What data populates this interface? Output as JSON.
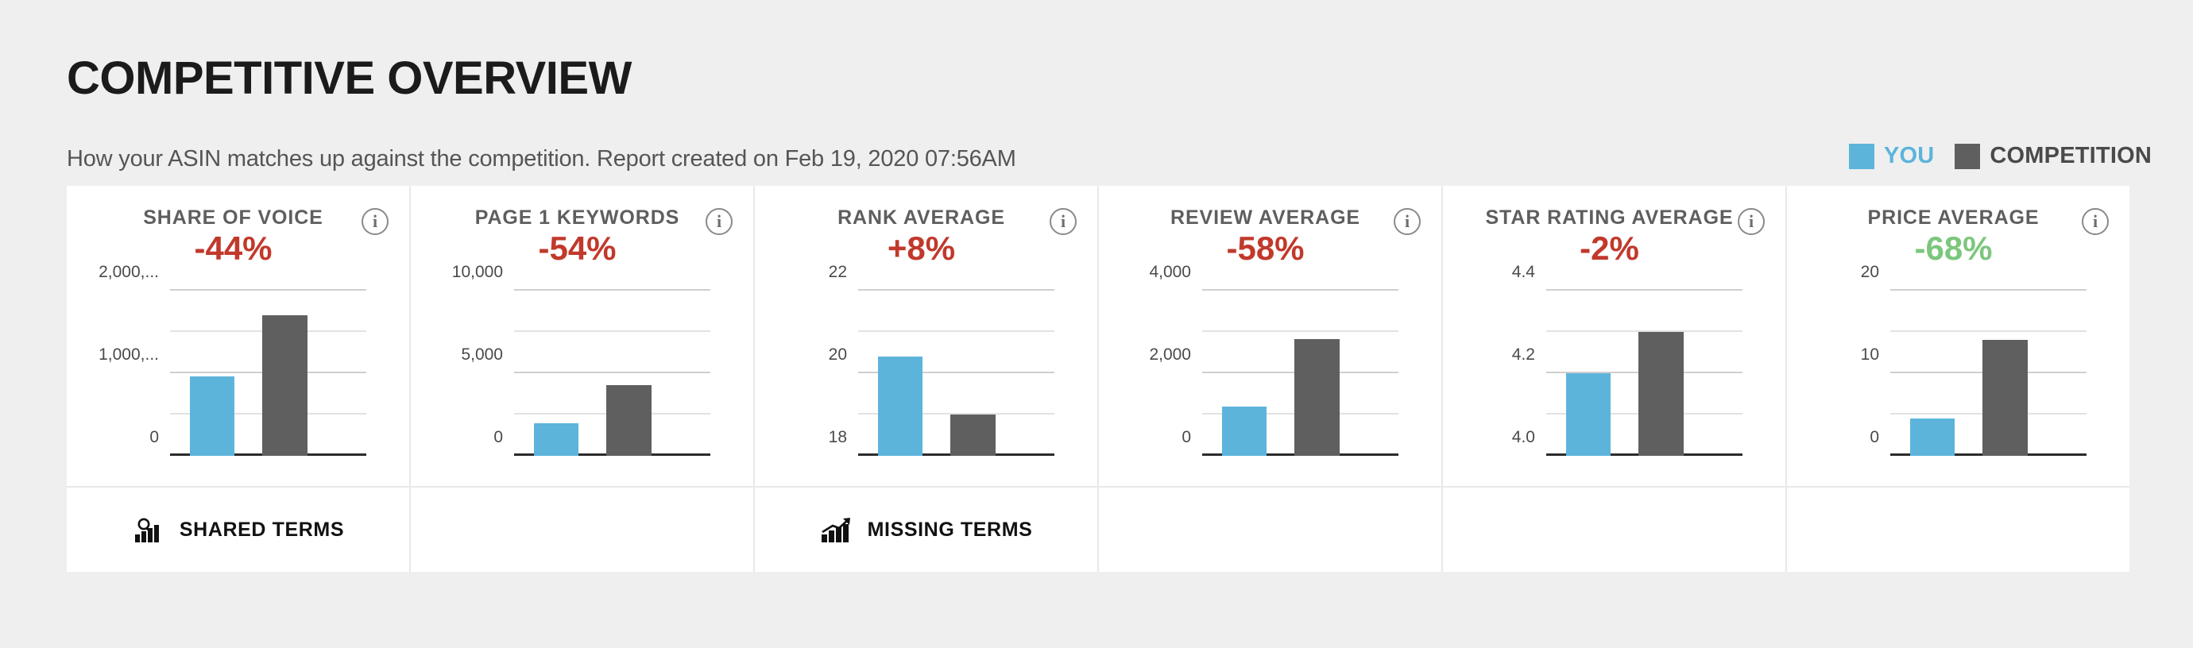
{
  "header": {
    "title": "COMPETITIVE OVERVIEW",
    "subtitle": "How your ASIN matches up against the competition. Report created on Feb 19, 2020 07:56AM"
  },
  "legend": {
    "you_label": "YOU",
    "you_color": "#5CB4DB",
    "competition_label": "COMPETITION",
    "competition_color": "#605F5F"
  },
  "colors": {
    "negative": "#C1392B",
    "positive": "#7DC67D",
    "page_background": "#EFEFEF",
    "card_background": "#FFFFFF",
    "divider": "#E8E8E8"
  },
  "info_icon_glyph": "i",
  "cards": [
    {
      "title": "SHARE OF VOICE",
      "delta": "-44%",
      "delta_sign": "negative",
      "info_icon": "info-icon",
      "footer": {
        "label": "SHARED TERMS",
        "icon": "shared-terms-icon"
      },
      "chart_data": {
        "type": "bar",
        "title": "SHARE OF VOICE",
        "categories": [
          "YOU",
          "COMPETITION"
        ],
        "values": [
          960000,
          1700000
        ],
        "series": [
          {
            "name": "YOU",
            "values": [
              960000
            ]
          },
          {
            "name": "COMPETITION",
            "values": [
              1700000
            ]
          }
        ],
        "ylim": [
          0,
          2000000
        ],
        "yticks": [
          0,
          1000000,
          2000000
        ],
        "ytick_labels": [
          "0",
          "1,000,...",
          "2,000,..."
        ],
        "minor_gridlines": [
          500000,
          1500000
        ],
        "xlabel": "",
        "ylabel": "",
        "grid": true,
        "legend": "top-right"
      }
    },
    {
      "title": "PAGE 1 KEYWORDS",
      "delta": "-54%",
      "delta_sign": "negative",
      "info_icon": "info-icon",
      "footer": null,
      "chart_data": {
        "type": "bar",
        "title": "PAGE 1 KEYWORDS",
        "categories": [
          "YOU",
          "COMPETITION"
        ],
        "values": [
          1950,
          4300
        ],
        "series": [
          {
            "name": "YOU",
            "values": [
              1950
            ]
          },
          {
            "name": "COMPETITION",
            "values": [
              4300
            ]
          }
        ],
        "ylim": [
          0,
          10000
        ],
        "yticks": [
          0,
          5000,
          10000
        ],
        "ytick_labels": [
          "0",
          "5,000",
          "10,000"
        ],
        "minor_gridlines": [
          2500,
          7500
        ],
        "xlabel": "",
        "ylabel": "",
        "grid": true,
        "legend": "top-right"
      }
    },
    {
      "title": "RANK AVERAGE",
      "delta": "+8%",
      "delta_sign": "negative",
      "info_icon": "info-icon",
      "footer": {
        "label": "MISSING TERMS",
        "icon": "missing-terms-icon"
      },
      "chart_data": {
        "type": "bar",
        "title": "RANK AVERAGE",
        "categories": [
          "YOU",
          "COMPETITION"
        ],
        "values": [
          20.4,
          19.0
        ],
        "series": [
          {
            "name": "YOU",
            "values": [
              20.4
            ]
          },
          {
            "name": "COMPETITION",
            "values": [
              19.0
            ]
          }
        ],
        "ylim": [
          18,
          22
        ],
        "yticks": [
          18,
          20,
          22
        ],
        "ytick_labels": [
          "18",
          "20",
          "22"
        ],
        "minor_gridlines": [
          19,
          21
        ],
        "xlabel": "",
        "ylabel": "",
        "grid": true,
        "legend": "top-right"
      }
    },
    {
      "title": "REVIEW AVERAGE",
      "delta": "-58%",
      "delta_sign": "negative",
      "info_icon": "info-icon",
      "footer": null,
      "chart_data": {
        "type": "bar",
        "title": "REVIEW AVERAGE",
        "categories": [
          "YOU",
          "COMPETITION"
        ],
        "values": [
          1200,
          2830
        ],
        "series": [
          {
            "name": "YOU",
            "values": [
              1200
            ]
          },
          {
            "name": "COMPETITION",
            "values": [
              2830
            ]
          }
        ],
        "ylim": [
          0,
          4000
        ],
        "yticks": [
          0,
          2000,
          4000
        ],
        "ytick_labels": [
          "0",
          "2,000",
          "4,000"
        ],
        "minor_gridlines": [
          1000,
          3000
        ],
        "xlabel": "",
        "ylabel": "",
        "grid": true,
        "legend": "top-right"
      }
    },
    {
      "title": "STAR RATING AVERAGE",
      "delta": "-2%",
      "delta_sign": "negative",
      "info_icon": "info-icon",
      "footer": null,
      "chart_data": {
        "type": "bar",
        "title": "STAR RATING AVERAGE",
        "categories": [
          "YOU",
          "COMPETITION"
        ],
        "values": [
          4.2,
          4.3
        ],
        "series": [
          {
            "name": "YOU",
            "values": [
              4.2
            ]
          },
          {
            "name": "COMPETITION",
            "values": [
              4.3
            ]
          }
        ],
        "ylim": [
          4.0,
          4.4
        ],
        "yticks": [
          4.0,
          4.2,
          4.4
        ],
        "ytick_labels": [
          "4.0",
          "4.2",
          "4.4"
        ],
        "minor_gridlines": [
          4.1,
          4.3
        ],
        "xlabel": "",
        "ylabel": "",
        "grid": true,
        "legend": "top-right"
      }
    },
    {
      "title": "PRICE AVERAGE",
      "delta": "-68%",
      "delta_sign": "positive",
      "info_icon": "info-icon",
      "footer": null,
      "chart_data": {
        "type": "bar",
        "title": "PRICE AVERAGE",
        "categories": [
          "YOU",
          "COMPETITION"
        ],
        "values": [
          4.5,
          14.0
        ],
        "series": [
          {
            "name": "YOU",
            "values": [
              4.5
            ]
          },
          {
            "name": "COMPETITION",
            "values": [
              14.0
            ]
          }
        ],
        "ylim": [
          0,
          20
        ],
        "yticks": [
          0,
          10,
          20
        ],
        "ytick_labels": [
          "0",
          "10",
          "20"
        ],
        "minor_gridlines": [
          5,
          15
        ],
        "xlabel": "",
        "ylabel": "",
        "grid": true,
        "legend": "top-right"
      }
    }
  ]
}
